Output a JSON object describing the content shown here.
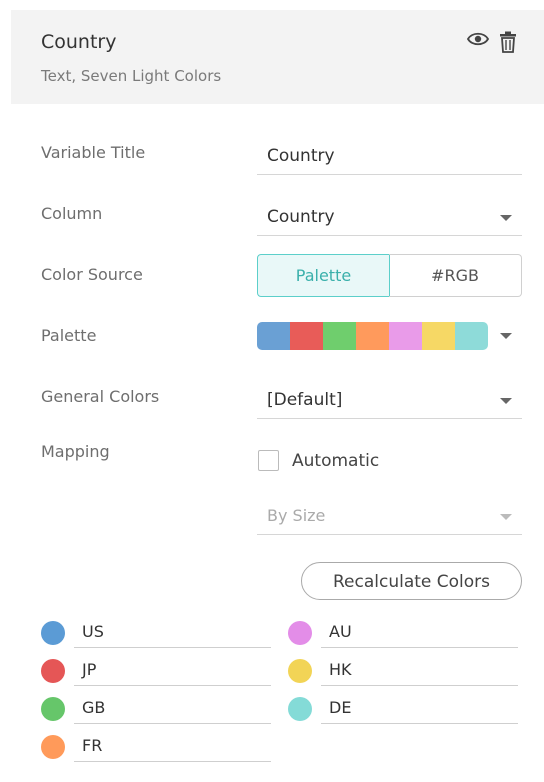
{
  "header": {
    "title": "Country",
    "subtitle": "Text, Seven Light Colors",
    "icons": {
      "view": "eye-icon",
      "delete": "trash-icon"
    }
  },
  "form": {
    "variable_title": {
      "label": "Variable Title",
      "value": "Country"
    },
    "column": {
      "label": "Column",
      "value": "Country"
    },
    "color_source": {
      "label": "Color Source",
      "options": [
        "Palette",
        "#RGB"
      ],
      "selected": "Palette"
    },
    "palette": {
      "label": "Palette",
      "colors": [
        "#6aa0d4",
        "#e85c58",
        "#6fce6d",
        "#ff9a5c",
        "#e99be9",
        "#f6d865",
        "#8edbd9"
      ]
    },
    "general_colors": {
      "label": "General Colors",
      "value": "[Default]"
    },
    "mapping": {
      "label": "Mapping",
      "automatic_label": "Automatic",
      "automatic_checked": false,
      "by_value": "By Size"
    },
    "recalculate_label": "Recalculate Colors"
  },
  "color_items": [
    {
      "name": "US",
      "color": "#5b9bd5"
    },
    {
      "name": "AU",
      "color": "#e38de8"
    },
    {
      "name": "JP",
      "color": "#e55656"
    },
    {
      "name": "HK",
      "color": "#f2d456"
    },
    {
      "name": "GB",
      "color": "#66c66a"
    },
    {
      "name": "DE",
      "color": "#84dbd7"
    },
    {
      "name": "FR",
      "color": "#ff9a5a"
    }
  ]
}
